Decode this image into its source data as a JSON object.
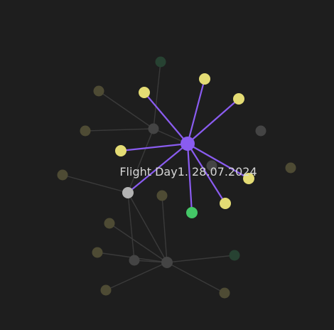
{
  "graph": {
    "hovered_label": "Flight Day1. 28.07.2024",
    "colors": {
      "background": "#1e1e1e",
      "active_edge": "#8a5cf0",
      "dim_edge": "#3a3a3a",
      "focus_node": "#8a5cf0",
      "linked_note": "#e4dc74",
      "linked_green": "#44c767",
      "linked_gray": "#b3b3b3",
      "dim_gray": "#444444",
      "dim_olive": "#4e4b34",
      "dim_green": "#274232"
    }
  }
}
